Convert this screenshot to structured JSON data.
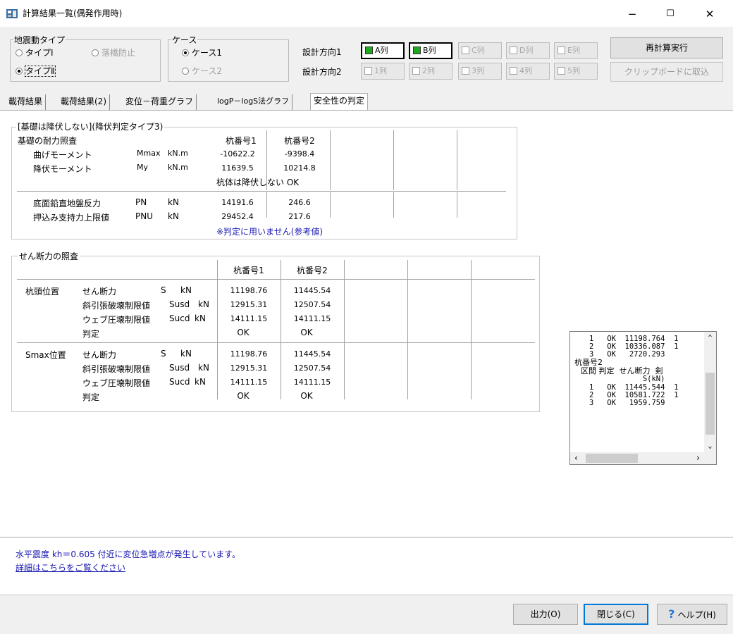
{
  "window": {
    "title": "計算結果一覧(偶発作用時)",
    "min": "−",
    "max": "☐",
    "close": "✕"
  },
  "quake_type": {
    "legend": "地震動タイプ",
    "type1": "タイプⅠ",
    "bridge": "落橋防止",
    "type2": "タイプⅡ"
  },
  "case": {
    "legend": "ケース",
    "case1": "ケース1",
    "case2": "ケース2"
  },
  "design": {
    "dir1_label": "設計方向1",
    "dir2_label": "設計方向2",
    "dir1_buttons": [
      "A列",
      "B列",
      "C列",
      "D列",
      "E列"
    ],
    "dir2_buttons": [
      "1列",
      "2列",
      "3列",
      "4列",
      "5列"
    ]
  },
  "buttons": {
    "recalc": "再計算実行",
    "clipboard": "クリップボードに取込",
    "output": "出力(O)",
    "close": "閉じる(C)",
    "help": "ヘルプ(H)"
  },
  "tabs": [
    "載荷結果",
    "載荷結果(2)",
    "変位－荷重グラフ",
    "logP－logS法グラフ",
    "安全性の判定"
  ],
  "group1": {
    "title": "[基礎は降伏しない](降伏判定タイプ3)",
    "check_title": "基礎の耐力照査",
    "col1": "杭番号1",
    "col2": "杭番号2",
    "rows": [
      {
        "label": "曲げモーメント",
        "sym": "Mmax",
        "unit": "kN.m",
        "v1": "-10622.2",
        "v2": "-9398.4"
      },
      {
        "label": "降伏モーメント",
        "sym": "My",
        "unit": "kN.m",
        "v1": "11639.5",
        "v2": "10214.8"
      }
    ],
    "result": "杭体は降伏しない OK",
    "rows2": [
      {
        "label": "底面鉛直地盤反力",
        "sym": "PN",
        "unit": "kN",
        "v1": "14191.6",
        "v2": "246.6"
      },
      {
        "label": "押込み支持力上限値",
        "sym": "PNU",
        "unit": "kN",
        "v1": "29452.4",
        "v2": "217.6"
      }
    ],
    "note": "※判定に用いません(参考値)"
  },
  "group2": {
    "title": "せん断力の照査",
    "col1": "杭番号1",
    "col2": "杭番号2",
    "sections": [
      {
        "pos": "杭頭位置",
        "rows": [
          {
            "label": "せん断力",
            "sym": "S",
            "unit": "kN",
            "v1": "11198.76",
            "v2": "11445.54"
          },
          {
            "label": "斜引張破壊制限値",
            "sym": "Susd",
            "unit": "kN",
            "v1": "12915.31",
            "v2": "12507.54"
          },
          {
            "label": "ウェブ圧壊制限値",
            "sym": "Sucd",
            "unit": "kN",
            "v1": "14111.15",
            "v2": "14111.15"
          },
          {
            "label": "判定",
            "sym": "",
            "unit": "",
            "v1": "OK",
            "v2": "OK"
          }
        ]
      },
      {
        "pos": "Smax位置",
        "rows": [
          {
            "label": "せん断力",
            "sym": "S",
            "unit": "kN",
            "v1": "11198.76",
            "v2": "11445.54"
          },
          {
            "label": "斜引張破壊制限値",
            "sym": "Susd",
            "unit": "kN",
            "v1": "12915.31",
            "v2": "12507.54"
          },
          {
            "label": "ウェブ圧壊制限値",
            "sym": "Sucd",
            "unit": "kN",
            "v1": "14111.15",
            "v2": "14111.15"
          },
          {
            "label": "判定",
            "sym": "",
            "unit": "",
            "v1": "OK",
            "v2": "OK"
          }
        ]
      }
    ]
  },
  "listbox": {
    "lines": [
      "   1   OK  11198.764  1",
      "   2   OK  10336.087  1",
      "   3   OK   2720.293",
      "杭番号2",
      "  区間 判定  せん断力  剣",
      "               S(kN)",
      "   1   OK  11445.544  1",
      "   2   OK  10581.722  1",
      "   3   OK   1959.759"
    ]
  },
  "message": {
    "line1": "水平震度 kh＝0.605 付近に変位急増点が発生しています。",
    "link": "詳細はこちらをご覧ください"
  }
}
